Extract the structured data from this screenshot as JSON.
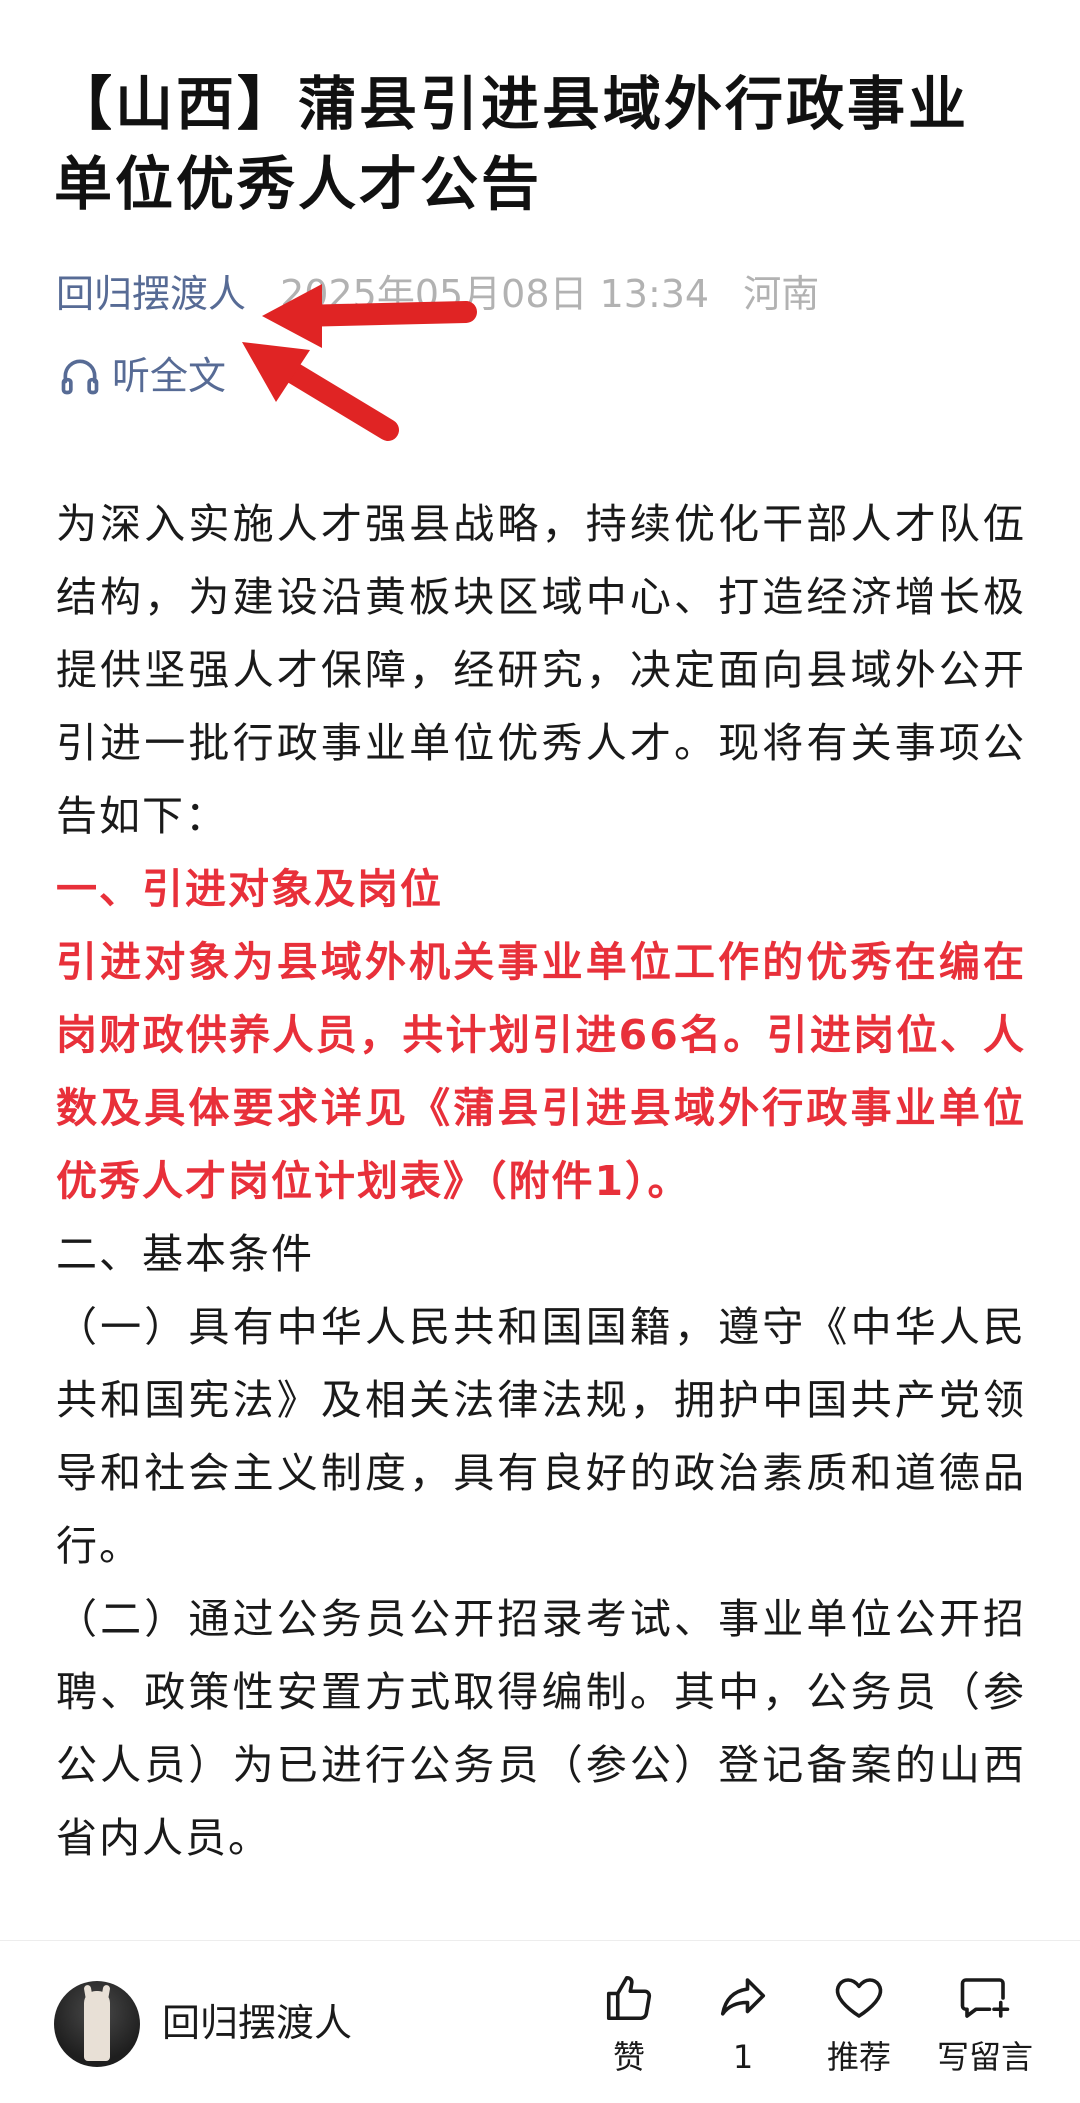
{
  "article": {
    "title": "【山西】蒲县引进县域外行政事业单位优秀人才公告",
    "author": "回归摆渡人",
    "date": "2025年05月08日 13:34",
    "location": "河南",
    "listen_label": "听全文",
    "paragraphs": [
      {
        "text": "为深入实施人才强县战略，持续优化干部人才队伍结构，为建设沿黄板块区域中心、打造经济增长极提供坚强人才保障，经研究，决定面向县域外公开引进一批行政事业单位优秀人才。现将有关事项公告如下：",
        "style": "normal"
      },
      {
        "text": "一、引进对象及岗位",
        "style": "red"
      },
      {
        "text": "引进对象为县域外机关事业单位工作的优秀在编在岗财政供养人员，共计划引进66名。引进岗位、人数及具体要求详见《蒲县引进县域外行政事业单位优秀人才岗位计划表》（附件1）。",
        "style": "red"
      },
      {
        "text": "二、基本条件",
        "style": "normal"
      },
      {
        "text": "（一）具有中华人民共和国国籍，遵守《中华人民共和国宪法》及相关法律法规，拥护中国共产党领导和社会主义制度，具有良好的政治素质和道德品行。",
        "style": "normal"
      },
      {
        "text": "（二）通过公务员公开招录考试、事业单位公开招聘、政策性安置方式取得编制。其中，公务员（参公人员）为已进行公务员（参公）登记备案的山西省内人员。",
        "style": "normal"
      }
    ]
  },
  "bottom_bar": {
    "author": "回归摆渡人",
    "like_label": "赞",
    "share_count": "1",
    "recommend_label": "推荐",
    "comment_label": "写留言"
  },
  "annotations": {
    "arrow_color": "#e02424"
  },
  "colors": {
    "link": "#576b95",
    "meta_gray": "#b2b2b2",
    "highlight_red": "#e8303a"
  }
}
